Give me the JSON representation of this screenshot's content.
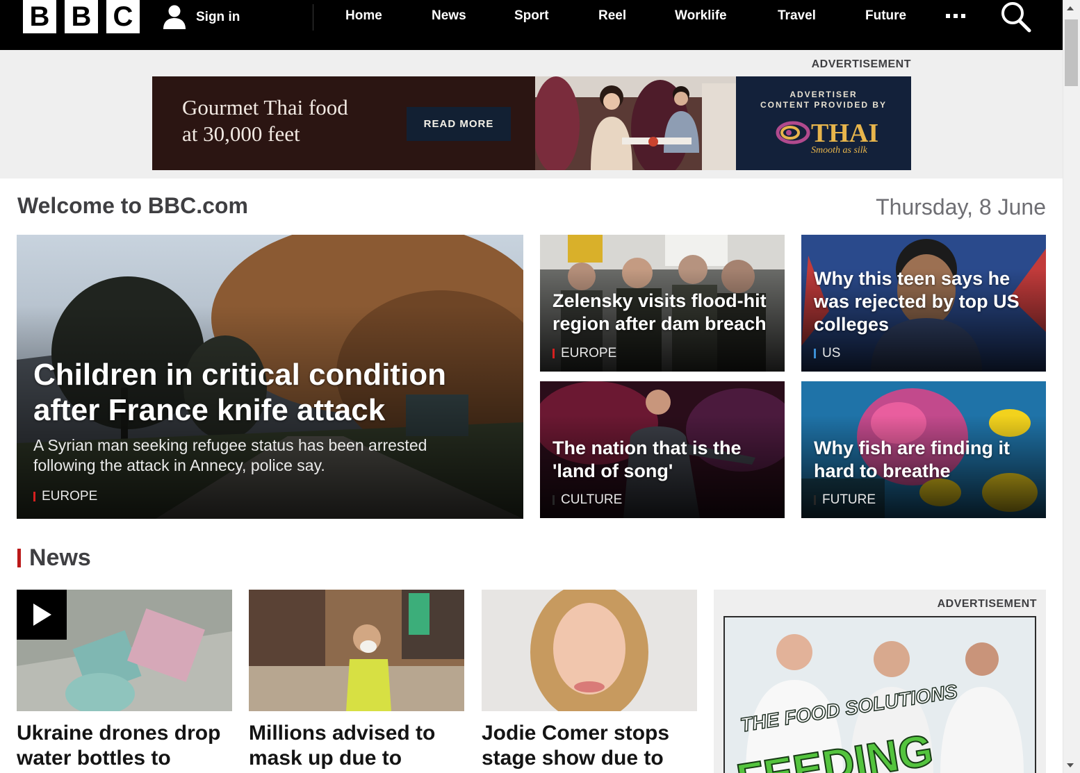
{
  "header": {
    "logo_letters": [
      "B",
      "B",
      "C"
    ],
    "signin_label": "Sign in",
    "nav_items": [
      "Home",
      "News",
      "Sport",
      "Reel",
      "Worklife",
      "Travel",
      "Future"
    ],
    "more_icon": "more-dots-icon",
    "search_icon": "search-icon"
  },
  "top_ad": {
    "label": "ADVERTISEMENT",
    "headline_line1": "Gourmet Thai food",
    "headline_line2": "at 30,000 feet",
    "button_label": "READ MORE",
    "caption_line1": "ADVERTISER",
    "caption_line2": "CONTENT PROVIDED BY",
    "brand_name": "THAI",
    "brand_tagline": "Smooth as silk"
  },
  "welcome": {
    "title": "Welcome to BBC.com",
    "date": "Thursday, 8 June"
  },
  "hero": {
    "main": {
      "title": "Children in critical condition after France knife attack",
      "summary": "A Syrian man seeking refugee status has been arrested following the attack in Annecy, police say.",
      "tag": "EUROPE",
      "tag_color": "#d6201f"
    },
    "tiles": [
      {
        "title": "Zelensky visits flood-hit region after dam breach",
        "tag": "EUROPE",
        "tag_color": "#d6201f"
      },
      {
        "title": "Why this teen says he was rejected by top US colleges",
        "tag": "US",
        "tag_color": "#3c8fd6"
      },
      {
        "title": "The nation that is the 'land of song'",
        "tag": "CULTURE",
        "tag_color": "#262626"
      },
      {
        "title": "Why fish are finding it hard to breathe",
        "tag": "FUTURE",
        "tag_color": "#262626"
      }
    ]
  },
  "news": {
    "heading": "News",
    "accent_color": "#bb1919",
    "cards": [
      {
        "headline": "Ukraine drones drop water bottles to",
        "has_video": true,
        "video_icon": "play-icon"
      },
      {
        "headline": "Millions advised to mask up due to",
        "has_video": false
      },
      {
        "headline": "Jodie Comer stops stage show due to",
        "has_video": false
      }
    ]
  },
  "side_ad": {
    "label": "ADVERTISEMENT",
    "text_line1": "THE FOOD SOLUTIONS",
    "text_line2": "FEEDING"
  }
}
